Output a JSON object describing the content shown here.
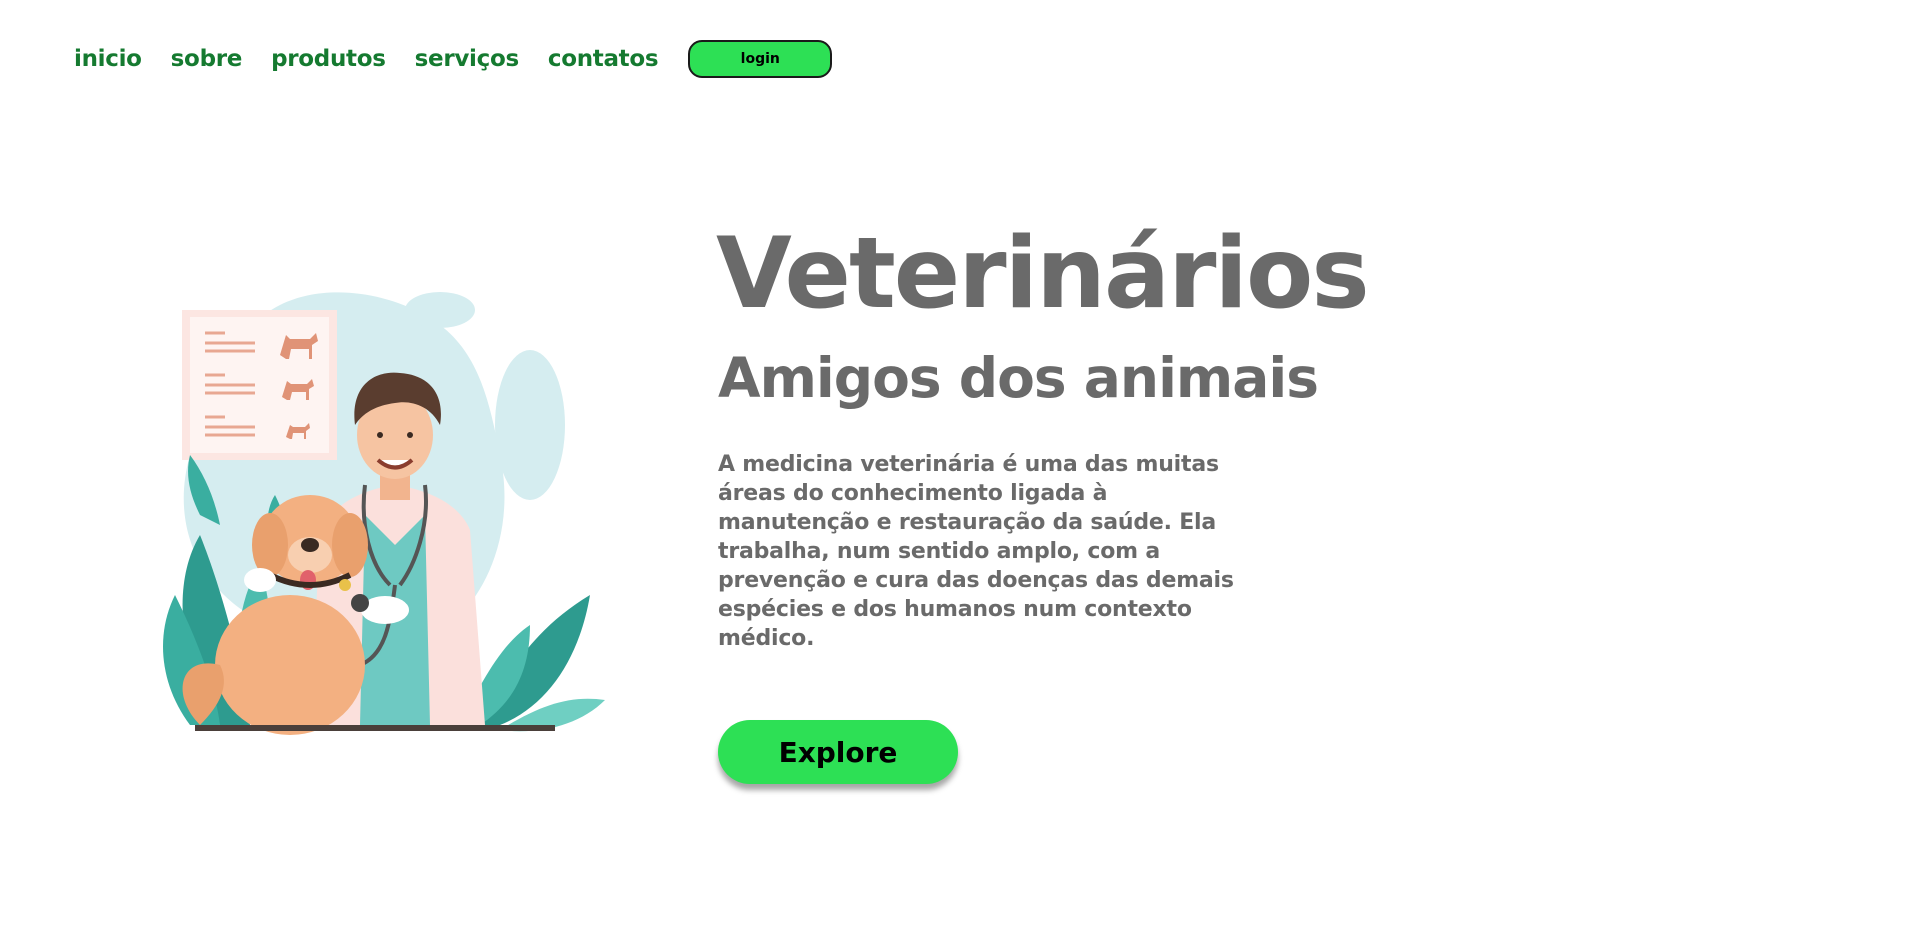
{
  "nav": {
    "items": [
      {
        "label": "inicio"
      },
      {
        "label": "sobre"
      },
      {
        "label": "produtos"
      },
      {
        "label": "serviços"
      },
      {
        "label": "contatos"
      }
    ],
    "login_label": "login"
  },
  "hero": {
    "title": "Veterinários",
    "subtitle": "Amigos dos animais",
    "description": "A medicina veterinária é uma das muitas áreas do conhecimento ligada à manutenção e restauração da saúde. Ela trabalha, num sentido amplo, com a prevenção e cura das doenças das demais espécies e dos humanos num contexto médico.",
    "explore_label": "Explore"
  },
  "colors": {
    "accent": "#2de055",
    "nav_text": "#157a30",
    "hero_text": "#6a6a6a"
  },
  "illustration": {
    "icon": "veterinarian-with-dog-illustration"
  }
}
